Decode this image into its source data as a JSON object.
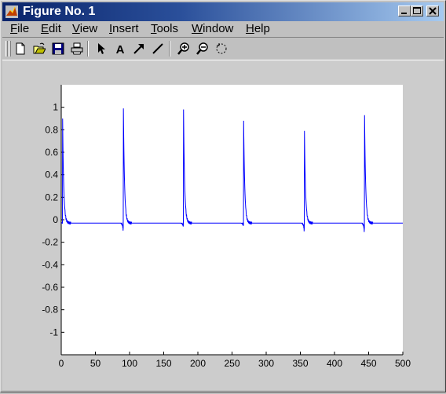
{
  "window": {
    "title": "Figure No. 1",
    "title_bar_color": "#0a246a"
  },
  "window_controls": [
    "minimize",
    "maximize",
    "close"
  ],
  "menu": [
    {
      "label": "File",
      "mnemonic": "F"
    },
    {
      "label": "Edit",
      "mnemonic": "E"
    },
    {
      "label": "View",
      "mnemonic": "V"
    },
    {
      "label": "Insert",
      "mnemonic": "I"
    },
    {
      "label": "Tools",
      "mnemonic": "T"
    },
    {
      "label": "Window",
      "mnemonic": "W"
    },
    {
      "label": "Help",
      "mnemonic": "H"
    }
  ],
  "toolbar": {
    "buttons": [
      "new-figure-icon",
      "open-file-icon",
      "save-icon",
      "print-icon",
      "select-arrow-icon",
      "insert-text-icon",
      "insert-arrow-icon",
      "insert-line-icon",
      "zoom-in-icon",
      "zoom-out-icon",
      "rotate-3d-icon"
    ]
  },
  "chart_data": {
    "type": "line",
    "title": "",
    "xlabel": "",
    "ylabel": "",
    "xlim": [
      0,
      500
    ],
    "ylim": [
      -1.2,
      1.2
    ],
    "xticks": [
      0,
      50,
      100,
      150,
      200,
      250,
      300,
      350,
      400,
      450,
      500
    ],
    "yticks": [
      -1,
      -0.8,
      -0.6,
      -0.4,
      -0.2,
      0,
      0.2,
      0.4,
      0.6,
      0.8,
      1
    ],
    "ytick_labels": [
      "-1",
      "-0.8",
      "-0.6",
      "-0.4",
      "-0.2",
      "0",
      "0.2",
      "0.4",
      "0.6",
      "0.8",
      "1"
    ],
    "grid": false,
    "line_color": "#0000ff",
    "baseline": -0.03,
    "peaks": [
      {
        "x": 2,
        "y": 0.9,
        "dip": -0.02
      },
      {
        "x": 91,
        "y": 0.99,
        "dip": -0.14
      },
      {
        "x": 179,
        "y": 0.98,
        "dip": -0.08
      },
      {
        "x": 267,
        "y": 0.88,
        "dip": -0.07
      },
      {
        "x": 356,
        "y": 0.79,
        "dip": -0.15
      },
      {
        "x": 444,
        "y": 0.93,
        "dip": -0.16
      }
    ]
  }
}
